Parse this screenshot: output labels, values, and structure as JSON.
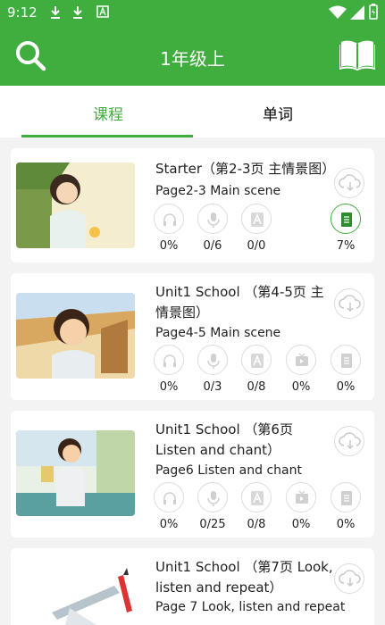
{
  "status": {
    "time": "9:12"
  },
  "header": {
    "title": "1年级上"
  },
  "tabs": [
    {
      "label": "课程",
      "active": true
    },
    {
      "label": "单词",
      "active": false
    }
  ],
  "lessons": [
    {
      "title": "Starter（第2-3页 主情景图）",
      "subtitle": "Page2-3 Main scene",
      "stats": [
        {
          "icon": "headphones-icon",
          "value": "0%"
        },
        {
          "icon": "microphone-icon",
          "value": "0/6"
        },
        {
          "icon": "letter-a-icon",
          "value": "0/0"
        },
        {
          "icon": "book-green-icon",
          "value": "7%"
        }
      ]
    },
    {
      "title": "Unit1 School （第4-5页 主情景图）",
      "subtitle": "Page4-5 Main scene",
      "stats": [
        {
          "icon": "headphones-icon",
          "value": "0%"
        },
        {
          "icon": "microphone-icon",
          "value": "0/3"
        },
        {
          "icon": "letter-a-icon",
          "value": "0/8"
        },
        {
          "icon": "video-icon",
          "value": "0%"
        },
        {
          "icon": "document-icon",
          "value": "0%"
        }
      ]
    },
    {
      "title": "Unit1 School （第6页 Listen and chant）",
      "subtitle": "Page6 Listen and chant",
      "stats": [
        {
          "icon": "headphones-icon",
          "value": "0%"
        },
        {
          "icon": "microphone-icon",
          "value": "0/25"
        },
        {
          "icon": "letter-a-icon",
          "value": "0/8"
        },
        {
          "icon": "video-icon",
          "value": "0%"
        },
        {
          "icon": "document-icon",
          "value": "0%"
        }
      ]
    },
    {
      "title": "Unit1 School （第7页 Look, listen and repeat）",
      "subtitle": "Page 7 Look, listen and repeat",
      "stats": []
    }
  ]
}
